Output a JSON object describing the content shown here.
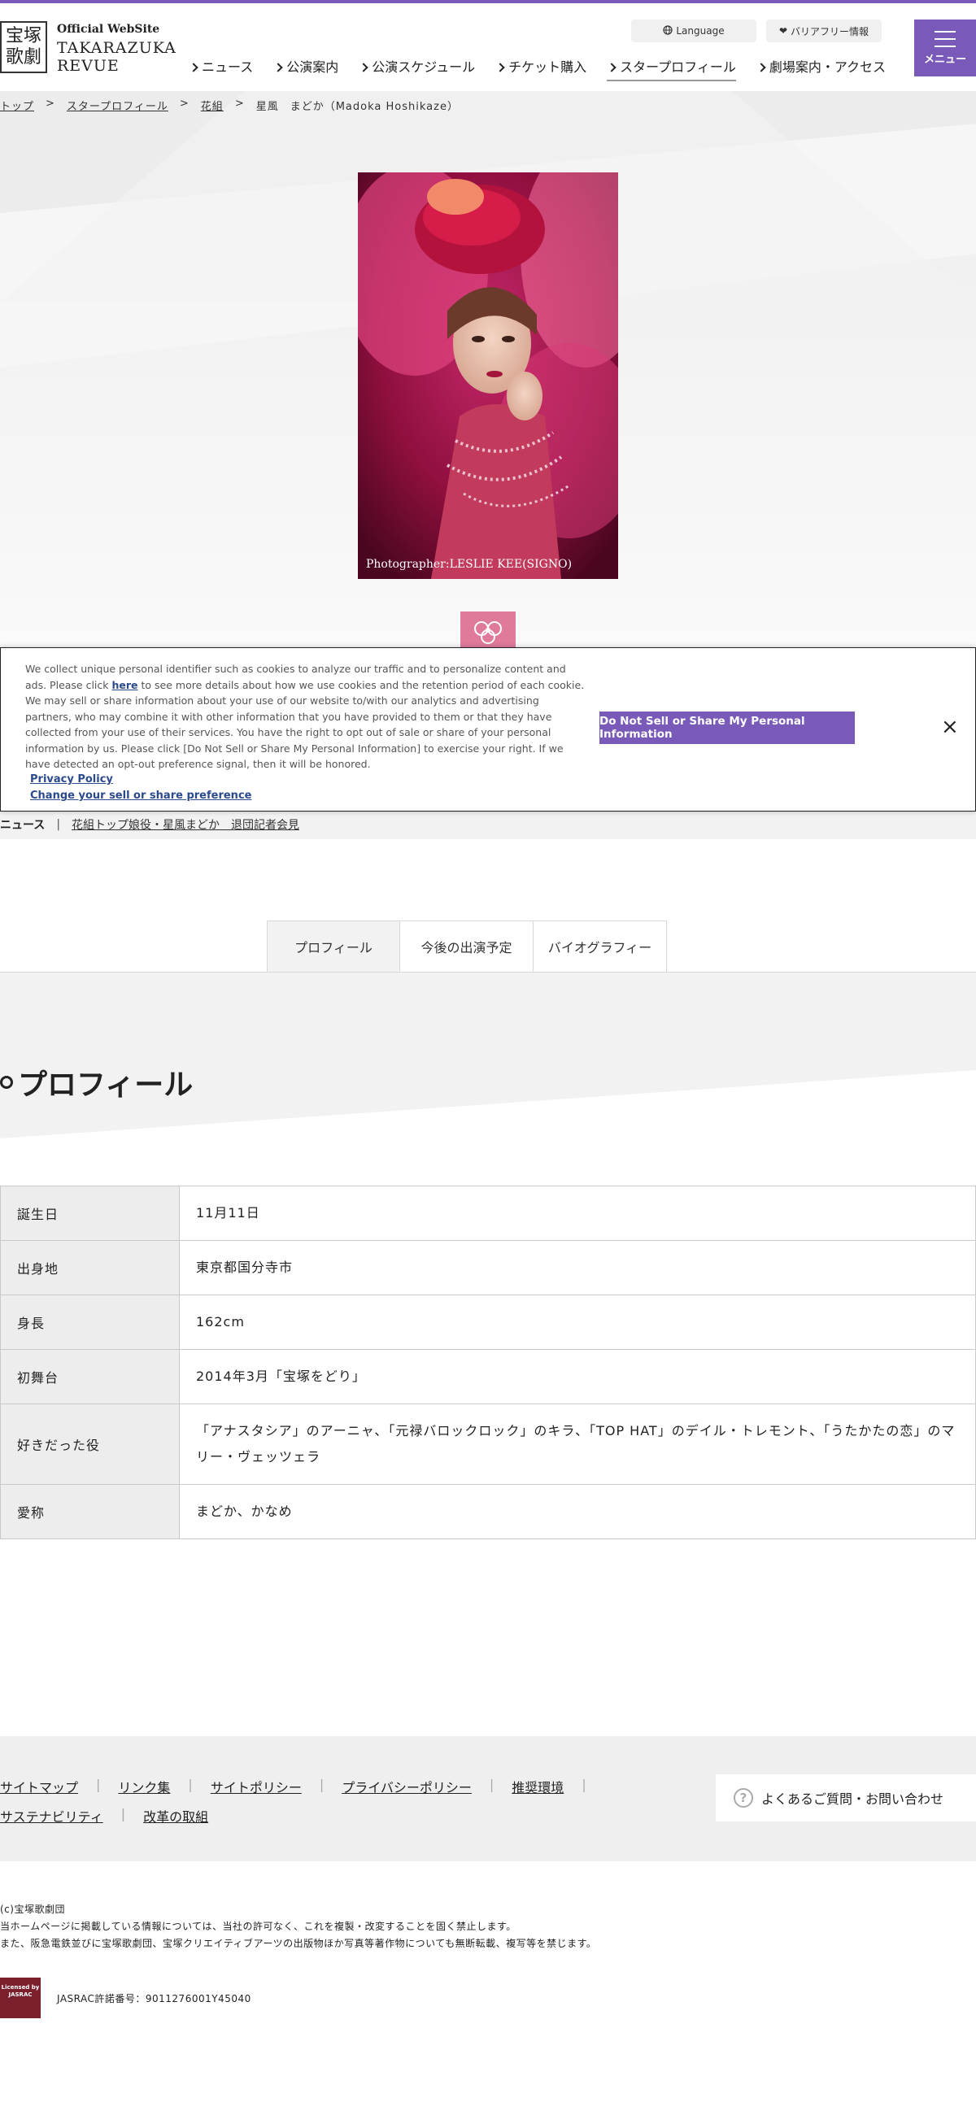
{
  "header": {
    "logo_kanji_top": "宝塚",
    "logo_kanji_bottom": "歌劇",
    "logo_sub": "Official WebSite",
    "logo_line1": "TAKARAZUKA",
    "logo_line2": "REVUE",
    "language_label": "Language",
    "barrierfree_label": "バリアフリー情報",
    "menu_label": "メニュー",
    "nav": [
      "ニュース",
      "公演案内",
      "公演スケジュール",
      "チケット購入",
      "スタープロフィール",
      "劇場案内・アクセス"
    ],
    "nav_active_index": 4,
    "accent_color": "#7a5ab8"
  },
  "breadcrumb": [
    "トップ",
    "スタープロフィール",
    "花組",
    "星風　まどか（Madoka Hoshikaze）"
  ],
  "photo": {
    "credit": "Photographer:LESLIE KEE(SIGNO)"
  },
  "troupe_icon": "flower-troupe-icon",
  "cookie_banner": {
    "text_before_link": "We collect unique personal identifier such as cookies to analyze our traffic and to personalize content and ads. Please click ",
    "link_here": "here",
    "text_after_link": " to see more details about how we use cookies and the retention period of each cookie. We may sell or share information about your use of our website to/with our analytics and advertising partners, who may combine it with other information that you have provided to them or that they have collected from your use of their services. You have the right to opt out of sale or share of your personal information by us. Please click [Do Not Sell or Share My Personal Information] to exercise your right. If we have detected an opt-out preference signal, then it will be honored.",
    "privacy_link": "Privacy Policy",
    "preference_link": "Change your sell or share preference",
    "button": "Do Not Sell or Share My Personal Information",
    "close": "×"
  },
  "news": {
    "label": "ニュース",
    "separator": "|",
    "link": "花組トップ娘役・星風まどか　退団記者会見"
  },
  "tabs": [
    "プロフィール",
    "今後の出演予定",
    "バイオグラフィー"
  ],
  "tabs_active_index": 0,
  "section_title": "プロフィール",
  "profile": [
    {
      "key": "誕生日",
      "value": "11月11日"
    },
    {
      "key": "出身地",
      "value": "東京都国分寺市"
    },
    {
      "key": "身長",
      "value": "162cm"
    },
    {
      "key": "初舞台",
      "value": "2014年3月「宝塚をどり」"
    },
    {
      "key": "好きだった役",
      "value": "「アナスタシア」のアーニャ、「元禄バロックロック」のキラ、「TOP HAT」のデイル・トレモント、「うたかたの恋」のマリー・ヴェッツェラ"
    },
    {
      "key": "愛称",
      "value": "まどか、かなめ"
    }
  ],
  "footer": {
    "links_row1": [
      "サイトマップ",
      "リンク集",
      "サイトポリシー",
      "プライバシーポリシー",
      "推奨環境"
    ],
    "links_row2": [
      "サステナビリティ",
      "改革の取組"
    ],
    "faq": "よくあるご質問・お問い合わせ",
    "copyright_lines": [
      "(c)宝塚歌劇団",
      "当ホームページに掲載している情報については、当社の許可なく、これを複製・改変することを固く禁止します。",
      "また、阪急電鉄並びに宝塚歌劇団、宝塚クリエイティブアーツの出版物ほか写真等著作物についても無断転載、複写等を禁じます。"
    ],
    "jasrac_badge": "Licensed by JASRAC",
    "jasrac_text": "JASRAC許諾番号：9011276001Y45040"
  }
}
